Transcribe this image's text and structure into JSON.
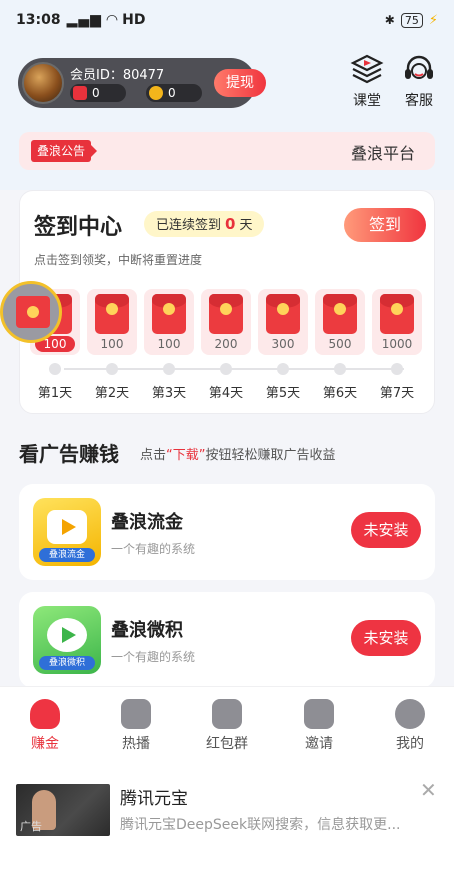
{
  "status": {
    "time": "13:08",
    "signal": "4G",
    "network": "HD",
    "battery": "75"
  },
  "member": {
    "id_label": "会员ID：80477",
    "red_count": "0",
    "gold_count": "0",
    "withdraw_label": "提现"
  },
  "top_links": [
    {
      "label": "课堂",
      "icon": "classroom-icon"
    },
    {
      "label": "客服",
      "icon": "headset-icon"
    }
  ],
  "notice": {
    "tag": "叠浪公告",
    "text": "叠浪平台"
  },
  "signin": {
    "title": "签到中心",
    "streak_prefix": "已连续签到",
    "streak_days": "0",
    "streak_suffix": "天",
    "button_label": "签到",
    "subtitle": "点击签到领奖，中断将重置进度",
    "days": [
      {
        "amount": "100",
        "label": "第1天"
      },
      {
        "amount": "100",
        "label": "第2天"
      },
      {
        "amount": "100",
        "label": "第3天"
      },
      {
        "amount": "200",
        "label": "第4天"
      },
      {
        "amount": "300",
        "label": "第5天"
      },
      {
        "amount": "500",
        "label": "第6天"
      },
      {
        "amount": "1000",
        "label": "第7天"
      }
    ]
  },
  "ads_section": {
    "title": "看广告赚钱",
    "sub_before": "点击",
    "sub_highlight": "“下载”",
    "sub_after": "按钮轻松赚取广告收益"
  },
  "apps": [
    {
      "name": "叠浪流金",
      "desc": "一个有趣的系统",
      "button": "未安装",
      "icon_caption": "叠浪流金"
    },
    {
      "name": "叠浪微积",
      "desc": "一个有趣的系统",
      "button": "未安装",
      "icon_caption": "叠浪微积"
    }
  ],
  "nav": [
    {
      "label": "赚金",
      "icon": "money-bag-icon",
      "active": true
    },
    {
      "label": "热播",
      "icon": "play-icon"
    },
    {
      "label": "红包群",
      "icon": "red-packet-icon"
    },
    {
      "label": "邀请",
      "icon": "handshake-icon"
    },
    {
      "label": "我的",
      "icon": "smile-icon"
    }
  ],
  "ad": {
    "title": "腾讯元宝",
    "desc": "腾讯元宝DeepSeek联网搜索，信息获取更...",
    "label": "广告"
  },
  "colors": {
    "accent": "#e8323c",
    "notice_bg": "#fde9ea",
    "card_bg": "#ffffff",
    "page_bg": "#f4f5f9"
  }
}
